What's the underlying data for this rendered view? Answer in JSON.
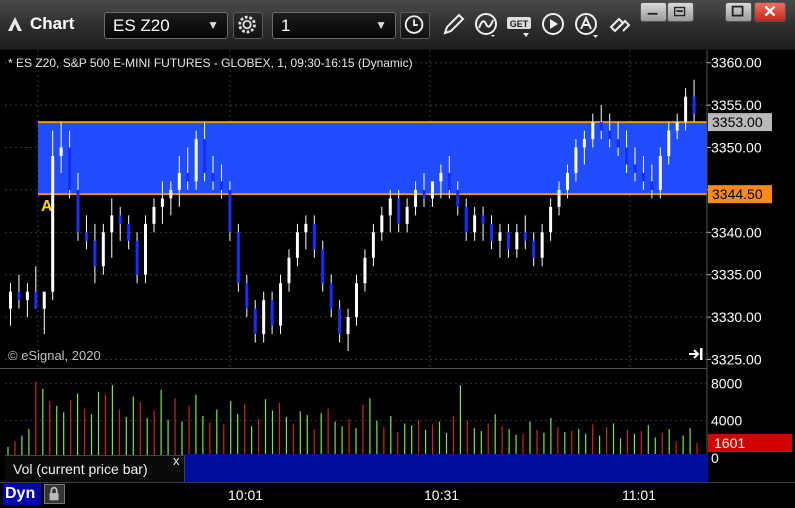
{
  "window": {
    "title": "Chart",
    "symbol": "ES Z20",
    "interval": "1",
    "buttons": {
      "minimize": "minimize",
      "restore": "restore",
      "maximize": "maximize",
      "close": "close"
    }
  },
  "toolbar_icons": [
    "settings-icon",
    "clock-icon",
    "pencil-icon",
    "curve-study-icon",
    "get-icon",
    "play-icon",
    "alert-icon",
    "link-icon"
  ],
  "chart": {
    "info": "* ES Z20, S&P 500 E-MINI FUTURES - GLOBEX, 1, 09:30-16:15 (Dynamic)",
    "copyright": "© eSignal, 2020",
    "marker": "A",
    "band_label_high": "3353.00",
    "band_label_low": "3344.50",
    "vol_current_label": "1601",
    "vol_legend": "Vol (current price bar)",
    "vol_legend_close": "x",
    "dyn": "Dyn"
  },
  "colors": {
    "band": "#1f4dff",
    "band_line": "#ff8a1a",
    "up_bar": "#ffffff",
    "down_bar": "#1a2dff",
    "vol_up": "#7ee34a",
    "vol_down": "#c4281c",
    "vol_current": "#d40000"
  },
  "chart_data": {
    "type": "candlestick",
    "price_axis": {
      "ticks": [
        "3360.00",
        "3355.00",
        "3350.00",
        "3345.00",
        "3340.00",
        "3335.00",
        "3330.00",
        "3325.00"
      ],
      "ylim": [
        3324,
        3361.5
      ]
    },
    "band": {
      "high": 3353.0,
      "low": 3344.5
    },
    "time_axis": {
      "ticks": [
        "10:01",
        "10:31",
        "11:01"
      ]
    },
    "volume_axis": {
      "ticks": [
        "8000",
        "4000",
        "0"
      ],
      "ylim": [
        0,
        9000
      ]
    },
    "bars": [
      [
        3331,
        3334,
        3329,
        3333
      ],
      [
        3333,
        3335,
        3331,
        3332
      ],
      [
        3332,
        3334,
        3330,
        3333
      ],
      [
        3333,
        3336,
        3331,
        3331
      ],
      [
        3331,
        3333,
        3328,
        3333
      ],
      [
        3333,
        3352,
        3332,
        3349
      ],
      [
        3349,
        3353,
        3347,
        3350
      ],
      [
        3350,
        3352,
        3344,
        3345
      ],
      [
        3345,
        3347,
        3339,
        3340
      ],
      [
        3340,
        3342,
        3338,
        3339
      ],
      [
        3339,
        3341,
        3334,
        3336
      ],
      [
        3336,
        3341,
        3335,
        3340
      ],
      [
        3340,
        3344,
        3337,
        3342
      ],
      [
        3342,
        3343,
        3339,
        3341
      ],
      [
        3341,
        3342,
        3338,
        3339
      ],
      [
        3339,
        3340,
        3334,
        3335
      ],
      [
        3335,
        3342,
        3334,
        3341
      ],
      [
        3341,
        3344,
        3340,
        3343
      ],
      [
        3343,
        3346,
        3341,
        3344
      ],
      [
        3344,
        3346,
        3342,
        3345
      ],
      [
        3345,
        3349,
        3343,
        3347
      ],
      [
        3347,
        3350,
        3345,
        3346
      ],
      [
        3346,
        3352,
        3345,
        3351
      ],
      [
        3351,
        3353,
        3346,
        3347
      ],
      [
        3347,
        3349,
        3345,
        3346
      ],
      [
        3346,
        3348,
        3344,
        3345
      ],
      [
        3345,
        3346,
        3339,
        3340
      ],
      [
        3340,
        3341,
        3333,
        3334
      ],
      [
        3334,
        3335,
        3330,
        3331
      ],
      [
        3331,
        3332,
        3327,
        3328
      ],
      [
        3328,
        3333,
        3327,
        3332
      ],
      [
        3332,
        3333,
        3328,
        3329
      ],
      [
        3329,
        3335,
        3328,
        3334
      ],
      [
        3334,
        3338,
        3333,
        3337
      ],
      [
        3337,
        3341,
        3336,
        3340
      ],
      [
        3340,
        3342,
        3338,
        3341
      ],
      [
        3341,
        3342,
        3337,
        3338
      ],
      [
        3338,
        3339,
        3333,
        3334
      ],
      [
        3334,
        3335,
        3330,
        3331
      ],
      [
        3331,
        3332,
        3327,
        3328
      ],
      [
        3328,
        3331,
        3326,
        3330
      ],
      [
        3330,
        3335,
        3329,
        3334
      ],
      [
        3334,
        3338,
        3333,
        3337
      ],
      [
        3337,
        3341,
        3336,
        3340
      ],
      [
        3340,
        3343,
        3339,
        3342
      ],
      [
        3342,
        3345,
        3340,
        3344
      ],
      [
        3344,
        3345,
        3340,
        3341
      ],
      [
        3341,
        3344,
        3340,
        3343
      ],
      [
        3343,
        3346,
        3342,
        3345
      ],
      [
        3345,
        3347,
        3343,
        3344
      ],
      [
        3344,
        3346,
        3343,
        3346
      ],
      [
        3346,
        3348,
        3344,
        3347
      ],
      [
        3347,
        3349,
        3344,
        3345
      ],
      [
        3345,
        3346,
        3342,
        3343
      ],
      [
        3343,
        3344,
        3339,
        3340
      ],
      [
        3340,
        3343,
        3339,
        3342
      ],
      [
        3342,
        3343,
        3339,
        3341
      ],
      [
        3341,
        3342,
        3338,
        3339
      ],
      [
        3339,
        3341,
        3337,
        3340
      ],
      [
        3340,
        3341,
        3337,
        3338
      ],
      [
        3338,
        3341,
        3337,
        3340
      ],
      [
        3340,
        3342,
        3338,
        3339
      ],
      [
        3339,
        3340,
        3336,
        3337
      ],
      [
        3337,
        3341,
        3336,
        3340
      ],
      [
        3340,
        3344,
        3339,
        3343
      ],
      [
        3343,
        3346,
        3342,
        3345
      ],
      [
        3345,
        3348,
        3344,
        3347
      ],
      [
        3347,
        3351,
        3346,
        3350
      ],
      [
        3350,
        3352,
        3348,
        3351
      ],
      [
        3351,
        3354,
        3350,
        3353
      ],
      [
        3353,
        3355,
        3351,
        3352
      ],
      [
        3352,
        3354,
        3350,
        3351
      ],
      [
        3351,
        3353,
        3349,
        3350
      ],
      [
        3350,
        3352,
        3347,
        3348
      ],
      [
        3348,
        3350,
        3346,
        3347
      ],
      [
        3347,
        3349,
        3345,
        3346
      ],
      [
        3346,
        3348,
        3344,
        3345
      ],
      [
        3345,
        3350,
        3344,
        3349
      ],
      [
        3349,
        3353,
        3348,
        3352
      ],
      [
        3352,
        3354,
        3351,
        3353
      ],
      [
        3353,
        3357,
        3352,
        3356
      ],
      [
        3356,
        3358,
        3353,
        3354
      ]
    ],
    "volume": [
      1200,
      1800,
      2400,
      3100,
      8200,
      7400,
      6100,
      5600,
      4900,
      6200,
      6900,
      5300,
      4700,
      7100,
      6800,
      7800,
      5200,
      4400,
      6600,
      6000,
      4300,
      5100,
      7300,
      4100,
      6400,
      3900,
      5600,
      6800,
      4500,
      3800,
      5200,
      3600,
      6100,
      4700,
      5800,
      3400,
      4200,
      6300,
      5100,
      5900,
      4400,
      3600,
      5000,
      4600,
      3100,
      4800,
      5300,
      3900,
      3400,
      4200,
      3200,
      5700,
      6400,
      4000,
      3300,
      4500,
      2800,
      3700,
      3500,
      4100,
      3000,
      3600,
      3900,
      2700,
      4500,
      7800,
      4000,
      3200,
      2900,
      3700,
      4700,
      3400,
      3100,
      2500,
      2600,
      3900,
      3000,
      2700,
      4300,
      3300,
      2800,
      2900,
      3100,
      2600,
      3600,
      2400,
      3300,
      3700,
      2100,
      3000,
      2600,
      2900,
      3500,
      2200,
      2700,
      3100,
      1800,
      2400,
      3200,
      1601
    ]
  }
}
